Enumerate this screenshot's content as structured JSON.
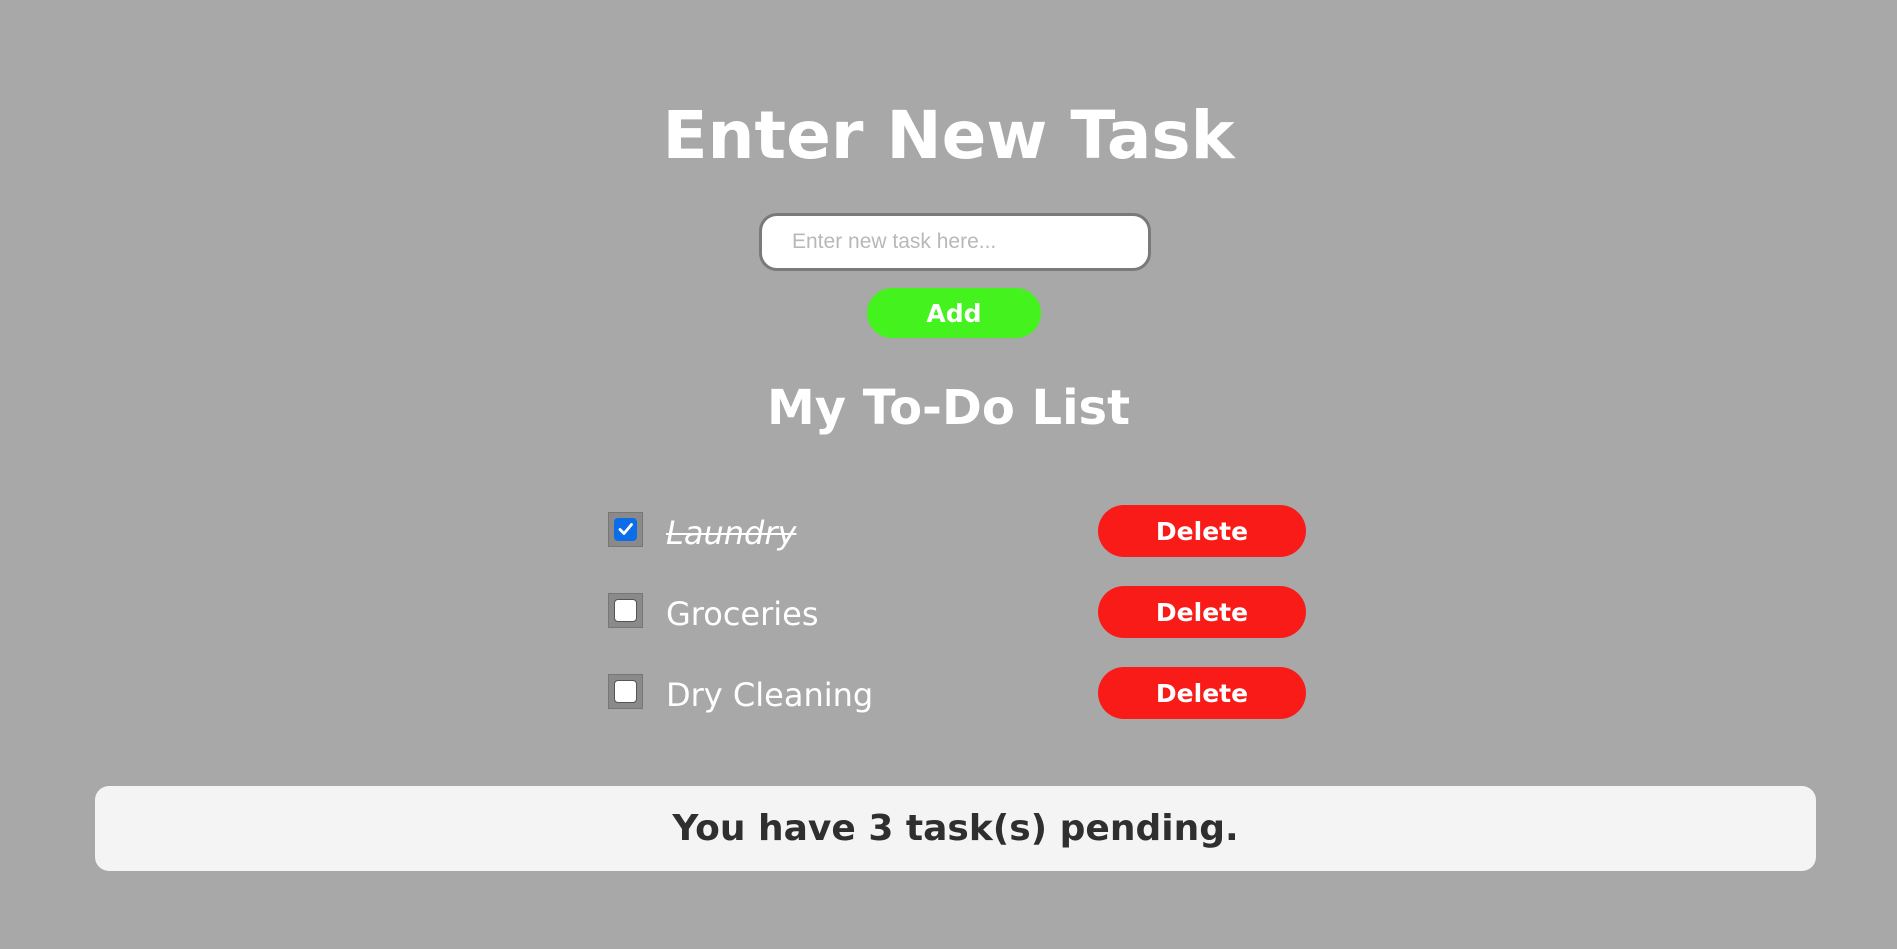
{
  "header": {
    "title": "Enter New Task"
  },
  "input": {
    "placeholder": "Enter new task here...",
    "value": ""
  },
  "add_button": {
    "label": "Add",
    "color": "#44f31d"
  },
  "list": {
    "title": "My To-Do List",
    "items": [
      {
        "label": "Laundry",
        "checked": true,
        "delete_label": "Delete"
      },
      {
        "label": "Groceries",
        "checked": false,
        "delete_label": "Delete"
      },
      {
        "label": "Dry Cleaning",
        "checked": false,
        "delete_label": "Delete"
      }
    ]
  },
  "status": {
    "text": "You have 3 task(s) pending."
  },
  "colors": {
    "background": "#a8a8a8",
    "delete": "#f81b17",
    "checkbox_checked": "#0b6ee8",
    "status_background": "#f4f4f4"
  },
  "icons": {
    "check": "checkmark-icon"
  }
}
